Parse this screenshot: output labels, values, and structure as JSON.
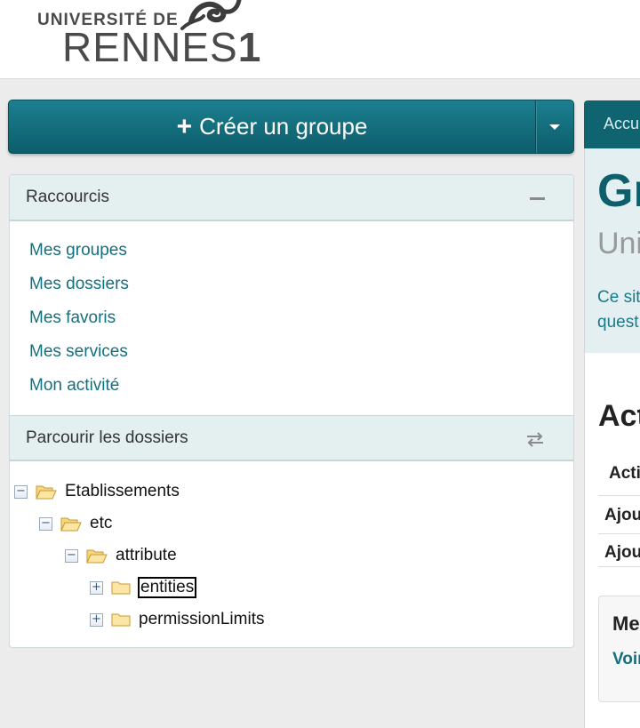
{
  "header": {
    "logo_line1": "UNIVERSITÉ DE",
    "logo_line2": "RENNES",
    "logo_digit": "1"
  },
  "create_button": {
    "label": "Créer un groupe"
  },
  "shortcuts": {
    "title": "Raccourcis",
    "items": [
      {
        "label": "Mes groupes"
      },
      {
        "label": "Mes dossiers"
      },
      {
        "label": "Mes favoris"
      },
      {
        "label": "Mes services"
      },
      {
        "label": "Mon activité"
      }
    ]
  },
  "browse": {
    "title": "Parcourir les dossiers",
    "tree": [
      {
        "label": "Etablissements",
        "expanded": true,
        "selected": false
      },
      {
        "label": "etc",
        "expanded": true,
        "selected": false
      },
      {
        "label": "attribute",
        "expanded": true,
        "selected": false
      },
      {
        "label": "entities",
        "expanded": false,
        "selected": true
      },
      {
        "label": "permissionLimits",
        "expanded": false,
        "selected": false
      }
    ]
  },
  "right": {
    "tab": "Accu",
    "hero_title": "Gr",
    "hero_subtitle": "Uni",
    "hero_desc_line1": "Ce sit",
    "hero_desc_line2": "quest",
    "activity_title": "Act",
    "activity_header": "Acti",
    "activity_rows": [
      "Ajou",
      "Ajou"
    ],
    "box_title": "Me",
    "box_link": "Voir"
  },
  "colors": {
    "accent": "#0f6470",
    "link": "#13707f",
    "panel_header_bg": "#e4eff0"
  }
}
